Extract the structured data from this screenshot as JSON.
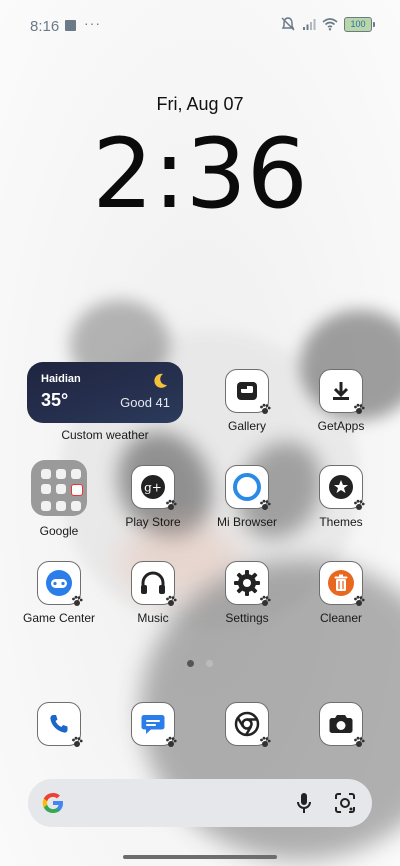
{
  "status_bar": {
    "time": "8:16",
    "overflow": "···",
    "battery": "100",
    "icons": [
      "notification-square-icon",
      "mute-icon",
      "signal-icon",
      "wifi-icon",
      "battery-icon"
    ]
  },
  "lock": {
    "date": "Fri, Aug 07",
    "time": "2:36"
  },
  "weather": {
    "city": "Haidian",
    "temp": "35°",
    "aqi": "Good 41",
    "label": "Custom weather"
  },
  "apps": [
    {
      "label": "Gallery",
      "icon": "gallery-icon"
    },
    {
      "label": "GetApps",
      "icon": "download-icon"
    },
    {
      "label": "Google",
      "icon": "folder-icon"
    },
    {
      "label": "Play Store",
      "icon": "google-plus-icon"
    },
    {
      "label": "Mi Browser",
      "icon": "browser-icon"
    },
    {
      "label": "Themes",
      "icon": "themes-icon"
    },
    {
      "label": "Game Center",
      "icon": "game-center-icon"
    },
    {
      "label": "Music",
      "icon": "headphones-icon"
    },
    {
      "label": "Settings",
      "icon": "gear-icon"
    },
    {
      "label": "Cleaner",
      "icon": "trash-icon"
    }
  ],
  "dock": [
    "phone-icon",
    "messages-icon",
    "chrome-icon",
    "camera-icon"
  ],
  "page_indicator": {
    "current": 1,
    "total": 2
  },
  "colors": {
    "accent_orange": "#e8681f",
    "accent_blue": "#2b7de9",
    "widget_bg": "#232b46"
  }
}
